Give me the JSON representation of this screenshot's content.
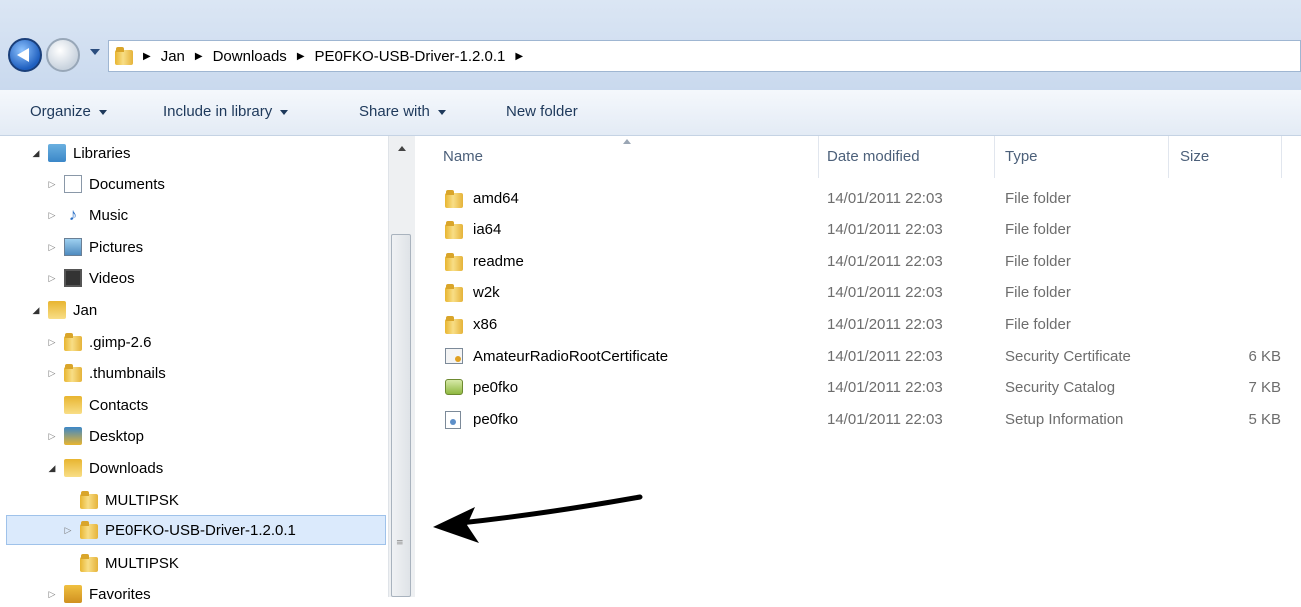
{
  "address": {
    "crumbs": [
      "Jan",
      "Downloads",
      "PE0FKO-USB-Driver-1.2.0.1"
    ],
    "separator": "▸"
  },
  "toolbar": {
    "organize": "Organize",
    "include": "Include in library",
    "share": "Share with",
    "new_folder": "New folder"
  },
  "nav": {
    "items": [
      {
        "label": "Libraries",
        "icon": "libraries-icon"
      },
      {
        "label": "Documents",
        "icon": "documents-icon"
      },
      {
        "label": "Music",
        "icon": "music-icon"
      },
      {
        "label": "Pictures",
        "icon": "pictures-icon"
      },
      {
        "label": "Videos",
        "icon": "videos-icon"
      },
      {
        "label": "Jan",
        "icon": "user-folder-icon"
      },
      {
        "label": ".gimp-2.6",
        "icon": "folder-icon"
      },
      {
        "label": ".thumbnails",
        "icon": "folder-icon"
      },
      {
        "label": "Contacts",
        "icon": "contacts-icon"
      },
      {
        "label": "Desktop",
        "icon": "desktop-icon"
      },
      {
        "label": "Downloads",
        "icon": "downloads-icon"
      },
      {
        "label": "MULTIPSK",
        "icon": "folder-icon"
      },
      {
        "label": "PE0FKO-USB-Driver-1.2.0.1",
        "icon": "folder-icon"
      },
      {
        "label": "MULTIPSK",
        "icon": "folder-icon"
      },
      {
        "label": "Favorites",
        "icon": "favorites-icon"
      }
    ]
  },
  "columns": {
    "name": "Name",
    "date": "Date modified",
    "type": "Type",
    "size": "Size"
  },
  "files": [
    {
      "name": "amd64",
      "date": "14/01/2011 22:03",
      "type": "File folder",
      "size": "",
      "icon": "folder-icon"
    },
    {
      "name": "ia64",
      "date": "14/01/2011 22:03",
      "type": "File folder",
      "size": "",
      "icon": "folder-icon"
    },
    {
      "name": "readme",
      "date": "14/01/2011 22:03",
      "type": "File folder",
      "size": "",
      "icon": "folder-icon"
    },
    {
      "name": "w2k",
      "date": "14/01/2011 22:03",
      "type": "File folder",
      "size": "",
      "icon": "folder-icon"
    },
    {
      "name": "x86",
      "date": "14/01/2011 22:03",
      "type": "File folder",
      "size": "",
      "icon": "folder-icon"
    },
    {
      "name": "AmateurRadioRootCertificate",
      "date": "14/01/2011 22:03",
      "type": "Security Certificate",
      "size": "6 KB",
      "icon": "certificate-icon"
    },
    {
      "name": "pe0fko",
      "date": "14/01/2011 22:03",
      "type": "Security Catalog",
      "size": "7 KB",
      "icon": "security-catalog-icon"
    },
    {
      "name": "pe0fko",
      "date": "14/01/2011 22:03",
      "type": "Setup Information",
      "size": "5 KB",
      "icon": "setup-info-icon"
    }
  ]
}
